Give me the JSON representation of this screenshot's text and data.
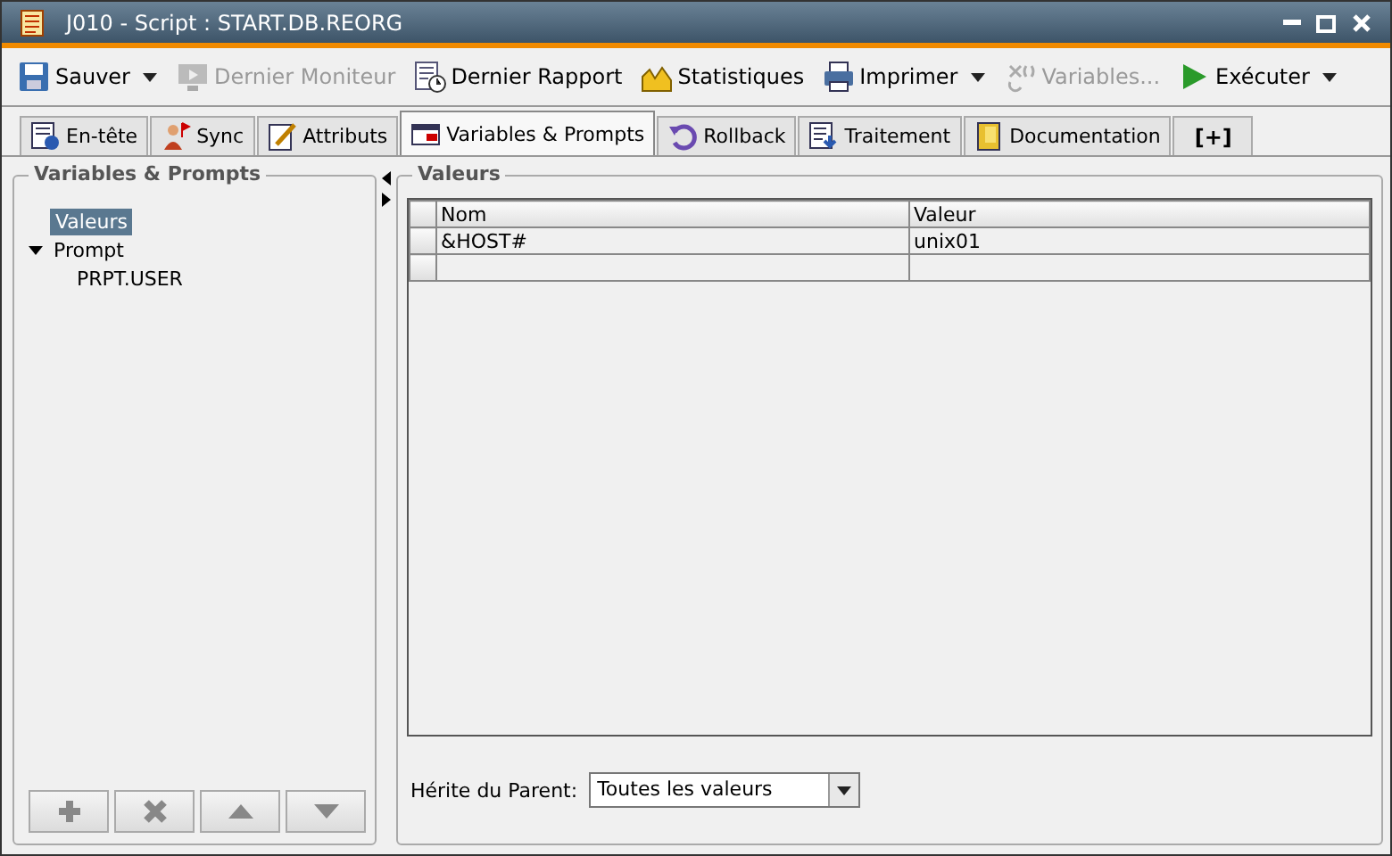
{
  "window": {
    "title": "J010 - Script : START.DB.REORG"
  },
  "toolbar": [
    {
      "kind": "save",
      "label": "Sauver",
      "disabled": false,
      "dropdown": true
    },
    {
      "kind": "monitor",
      "label": "Dernier Moniteur",
      "disabled": true,
      "dropdown": false
    },
    {
      "kind": "report",
      "label": "Dernier Rapport",
      "disabled": false,
      "dropdown": false
    },
    {
      "kind": "stats",
      "label": "Statistiques",
      "disabled": false,
      "dropdown": false
    },
    {
      "kind": "print",
      "label": "Imprimer",
      "disabled": false,
      "dropdown": true
    },
    {
      "kind": "vars",
      "label": "Variables...",
      "disabled": true,
      "dropdown": false
    },
    {
      "kind": "run",
      "label": "Exécuter",
      "disabled": false,
      "dropdown": true
    }
  ],
  "tabs": [
    {
      "kind": "header",
      "label": "En-tête",
      "selected": false
    },
    {
      "kind": "sync",
      "label": "Sync",
      "selected": false
    },
    {
      "kind": "attr",
      "label": "Attributs",
      "selected": false
    },
    {
      "kind": "vars",
      "label": "Variables & Prompts",
      "selected": true
    },
    {
      "kind": "rollback",
      "label": "Rollback",
      "selected": false
    },
    {
      "kind": "process",
      "label": "Traitement",
      "selected": false
    },
    {
      "kind": "doc",
      "label": "Documentation",
      "selected": false
    },
    {
      "kind": "add",
      "label": "[+]",
      "selected": false
    }
  ],
  "sidebar": {
    "title": "Variables & Prompts",
    "items": [
      {
        "label": "Valeurs",
        "selected": true
      },
      {
        "label": "Prompt",
        "selected": false,
        "expanded": true,
        "children": [
          {
            "label": "PRPT.USER",
            "selected": false
          }
        ]
      }
    ],
    "buttons": [
      {
        "kind": "add",
        "disabled": true
      },
      {
        "kind": "delete",
        "disabled": true
      },
      {
        "kind": "up",
        "disabled": true
      },
      {
        "kind": "down",
        "disabled": true
      }
    ]
  },
  "values": {
    "title": "Valeurs",
    "table": {
      "columns": [
        "Nom",
        "Valeur"
      ],
      "rows": [
        [
          "&HOST#",
          "unix01"
        ]
      ]
    },
    "inherit": {
      "label": "Hérite du Parent:",
      "value": "Toutes les valeurs"
    }
  }
}
